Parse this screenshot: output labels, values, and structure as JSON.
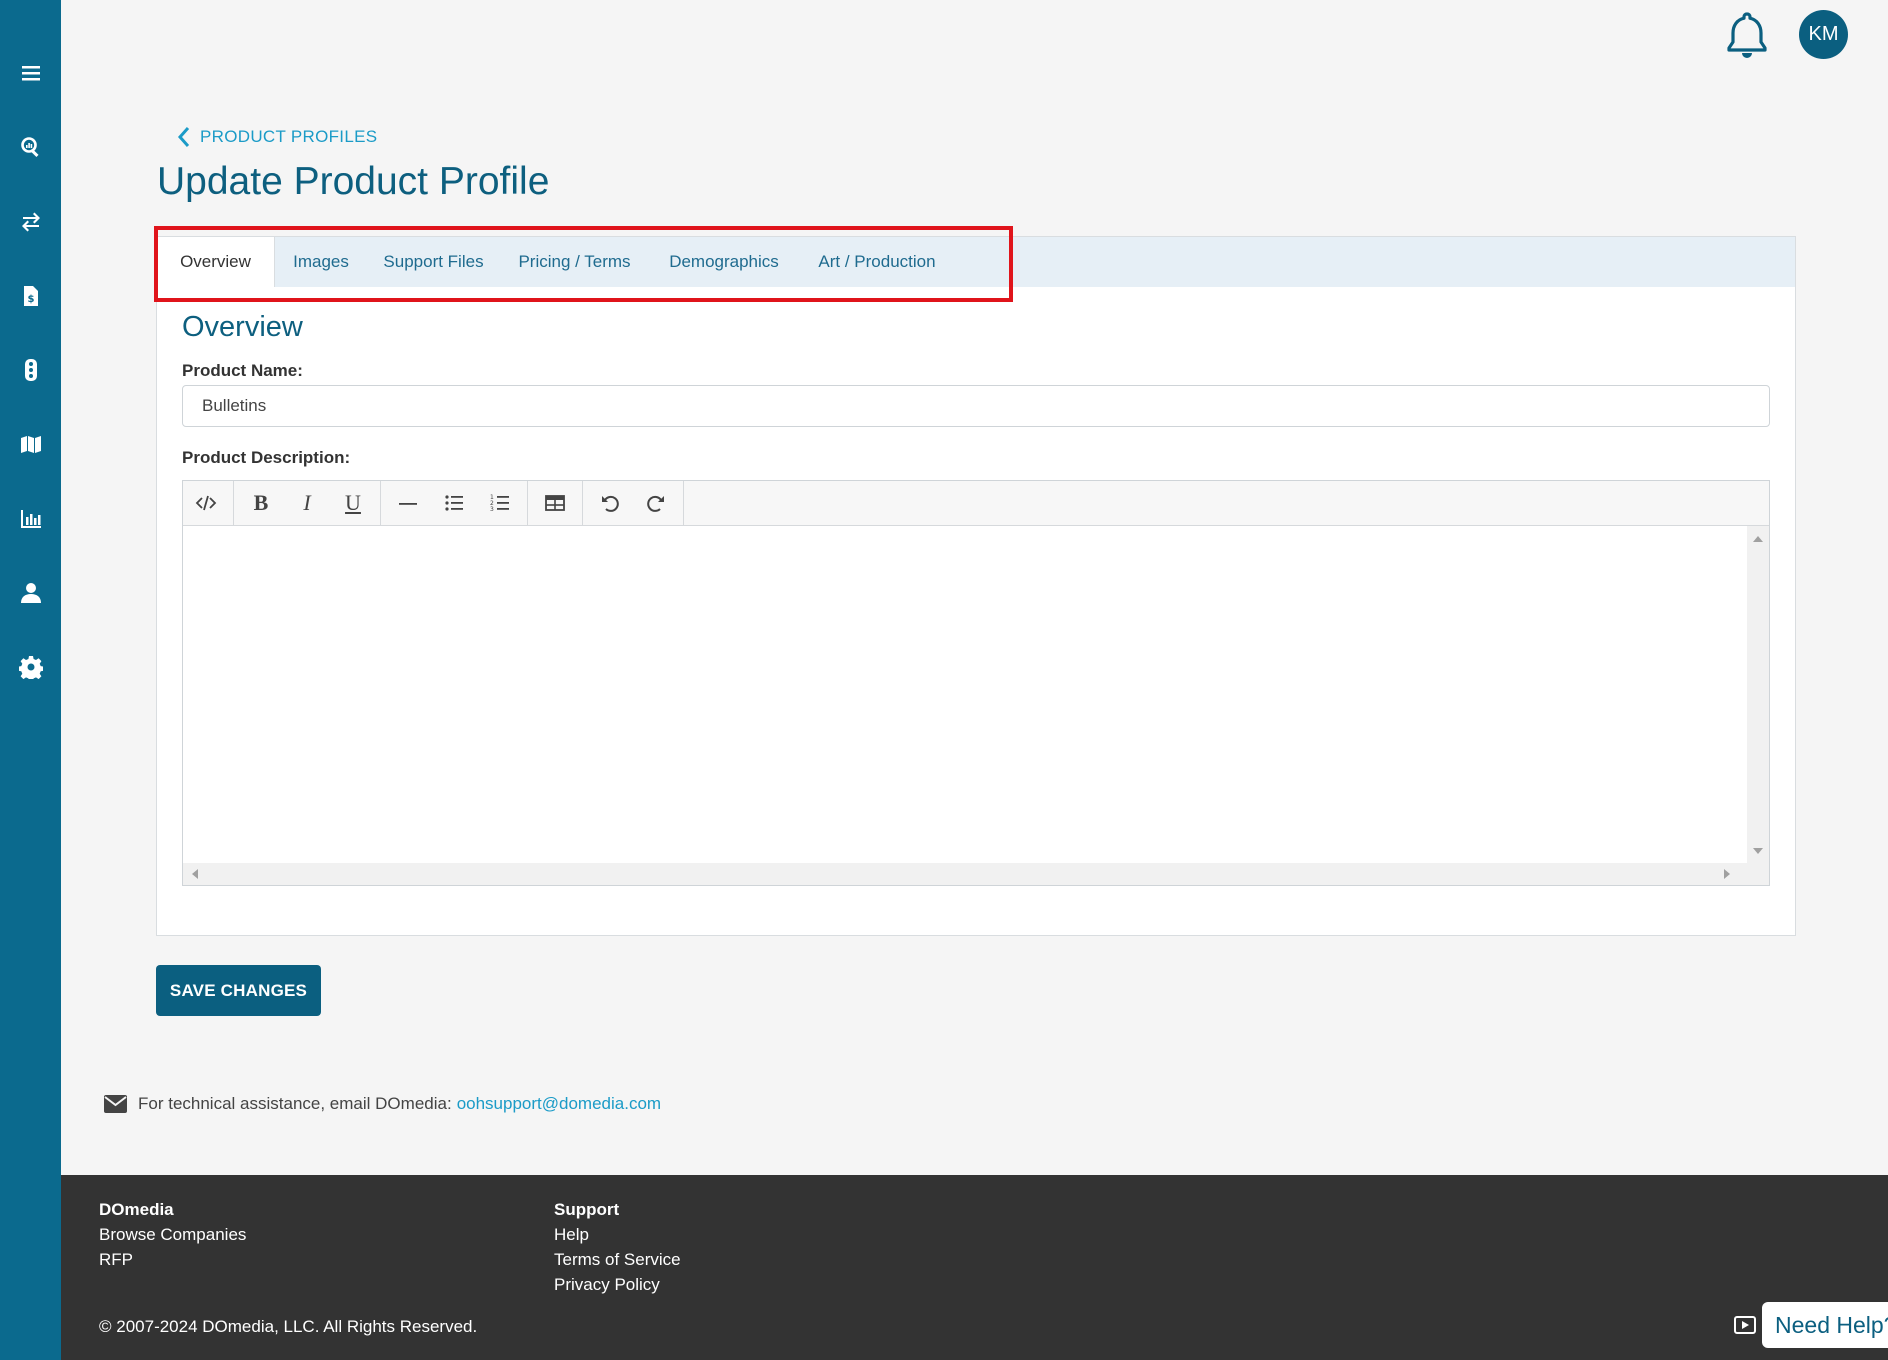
{
  "sidebar": {
    "items": [
      "menu-icon",
      "search-analytics-icon",
      "swap-icon",
      "invoice-icon",
      "traffic-light-icon",
      "map-icon",
      "bar-chart-icon",
      "user-icon",
      "gear-icon"
    ]
  },
  "header": {
    "avatar_initials": "KM"
  },
  "breadcrumb": {
    "label": "PRODUCT PROFILES"
  },
  "page": {
    "title": "Update Product Profile"
  },
  "tabs": [
    {
      "label": "Overview",
      "active": true
    },
    {
      "label": "Images",
      "active": false
    },
    {
      "label": "Support Files",
      "active": false
    },
    {
      "label": "Pricing / Terms",
      "active": false
    },
    {
      "label": "Demographics",
      "active": false
    },
    {
      "label": "Art / Production",
      "active": false
    }
  ],
  "overview": {
    "section_title": "Overview",
    "product_name_label": "Product Name:",
    "product_name_value": "Bulletins",
    "product_description_label": "Product Description:",
    "product_description_value": ""
  },
  "editor_toolbar": [
    "code-view-icon",
    "bold-icon",
    "italic-icon",
    "underline-icon",
    "horizontal-rule-icon",
    "bullet-list-icon",
    "numbered-list-icon",
    "table-icon",
    "undo-icon",
    "redo-icon"
  ],
  "actions": {
    "save_label": "SAVE CHANGES"
  },
  "support": {
    "text": "For technical assistance, email DOmedia:",
    "email": "oohsupport@domedia.com"
  },
  "footer": {
    "col1_head": "DOmedia",
    "col1_links": [
      "Browse Companies",
      "RFP"
    ],
    "col2_head": "Support",
    "col2_links": [
      "Help",
      "Terms of Service",
      "Privacy Policy"
    ],
    "copyright": "© 2007-2024 DOmedia, LLC. All Rights Reserved.",
    "need_help": "Need Help?"
  },
  "colors": {
    "sidebar": "#0b6a8e",
    "primary": "#0b5f80",
    "link": "#1b9bc7",
    "highlight": "#e0141b",
    "footer": "#333333"
  }
}
